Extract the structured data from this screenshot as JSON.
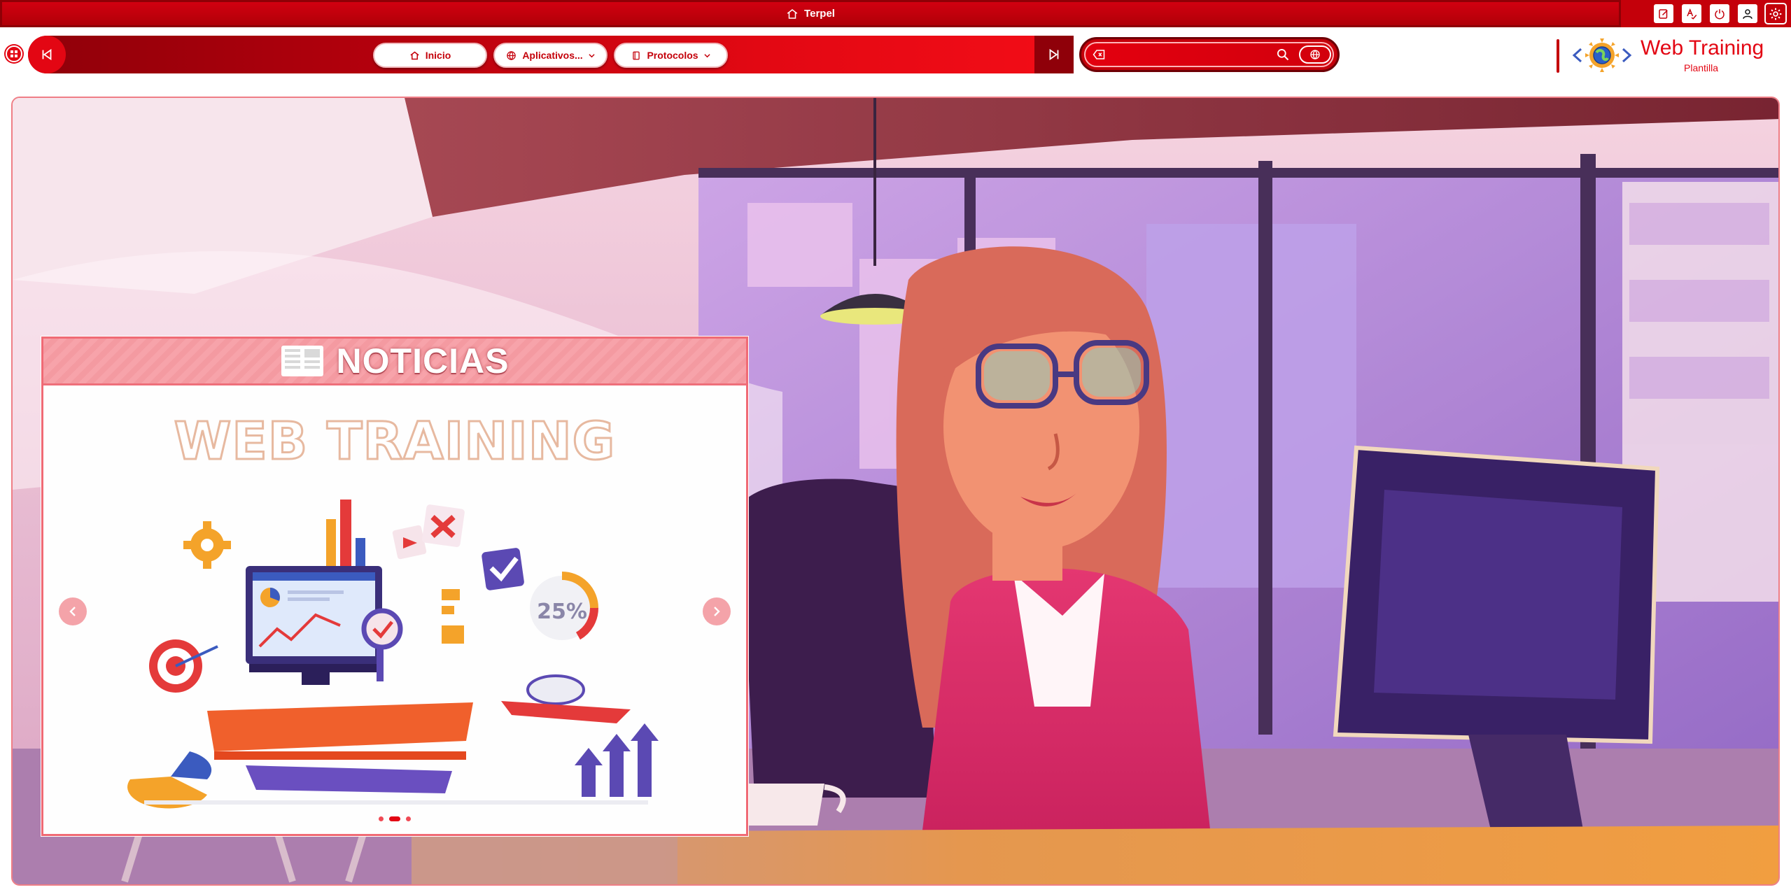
{
  "titlebar": {
    "title": "Terpel",
    "actions": [
      "edit-icon",
      "spellcheck-icon",
      "power-icon",
      "user-icon",
      "gear-icon"
    ]
  },
  "nav": {
    "home_label": "Inicio",
    "apps_label": "Aplicativos...",
    "protocols_label": "Protocolos"
  },
  "search": {
    "placeholder": "",
    "value": ""
  },
  "brand": {
    "title": "Web Training",
    "subtitle": "Plantilla"
  },
  "news": {
    "header": "NOTICIAS",
    "slide_title": "WEB TRAINING",
    "slide_graphic_text": "25%",
    "slides_total": 3,
    "active_slide": 2
  },
  "colors": {
    "brand_red": "#e30613",
    "dark_red": "#8f0009",
    "accent_pink": "#f4a3a9"
  }
}
